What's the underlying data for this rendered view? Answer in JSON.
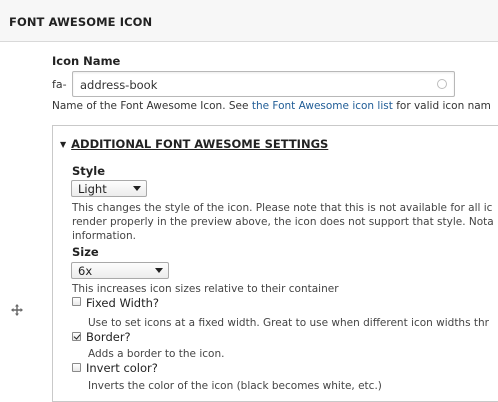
{
  "header": {
    "title": "FONT AWESOME ICON"
  },
  "icon_name": {
    "label": "Icon Name",
    "prefix": "fa-",
    "value": "address-book",
    "description_before": "Name of the Font Awesome Icon. See ",
    "description_link": "the Font Awesome icon list",
    "description_after": " for valid icon nam"
  },
  "settings": {
    "summary": "ADDITIONAL FONT AWESOME SETTINGS",
    "style": {
      "label": "Style",
      "value": "Light",
      "help_lines": [
        "This changes the style of the icon. Please note that this is not available for all ic",
        "render properly in the preview above, the icon does not support that style. Nota",
        "information."
      ]
    },
    "size": {
      "label": "Size",
      "value": "6x",
      "help": "This increases icon sizes relative to their container"
    },
    "fixed_width": {
      "label": "Fixed Width?",
      "checked": false,
      "help": "Use to set icons at a fixed width. Great to use when different icon widths thr"
    },
    "border": {
      "label": "Border?",
      "checked": true,
      "help": "Adds a border to the icon."
    },
    "invert": {
      "label": "Invert color?",
      "checked": false,
      "help": "Inverts the color of the icon (black becomes white, etc.)"
    }
  },
  "colors": {
    "link": "#1f5c96",
    "header_bg": "#f7f7f7"
  }
}
